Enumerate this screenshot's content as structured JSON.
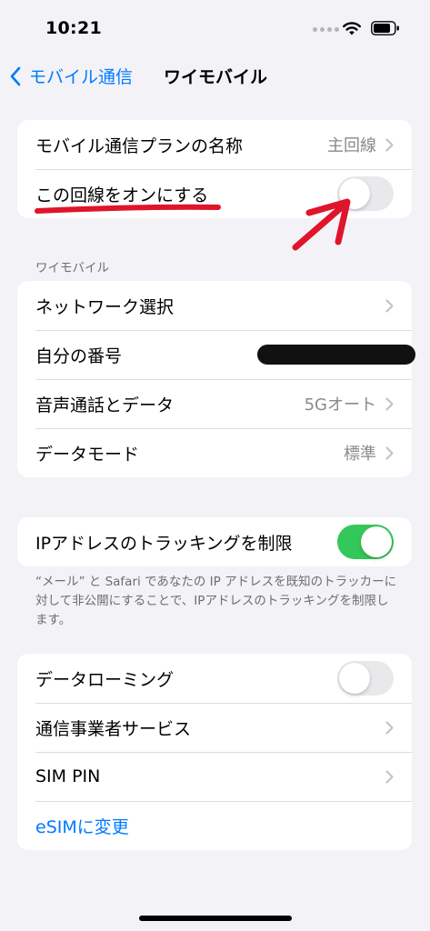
{
  "status_bar": {
    "time": "10:21"
  },
  "nav": {
    "back_label": "モバイル通信",
    "title": "ワイモバイル"
  },
  "group1": {
    "plan_label": "モバイル通信プランの名称",
    "plan_value": "主回線",
    "turn_on_label": "この回線をオンにする",
    "turn_on_state": false
  },
  "section_header": "ワイモバイル",
  "group2": {
    "network_label": "ネットワーク選択",
    "my_number_label": "自分の番号",
    "voice_data_label": "音声通話とデータ",
    "voice_data_value": "5Gオート",
    "data_mode_label": "データモード",
    "data_mode_value": "標準"
  },
  "group3": {
    "ip_label": "IPアドレスのトラッキングを制限",
    "ip_state": true,
    "footer": "“メール” と Safari であなたの IP アドレスを既知のトラッカーに対して非公開にすることで、IPアドレスのトラッキングを制限します。"
  },
  "group4": {
    "roaming_label": "データローミング",
    "roaming_state": false,
    "carrier_services_label": "通信事業者サービス",
    "sim_pin_label": "SIM PIN",
    "esim_label": "eSIMに変更"
  },
  "colors": {
    "accent": "#007aff",
    "toggle_on": "#34c759",
    "annotation": "#e0142a"
  }
}
